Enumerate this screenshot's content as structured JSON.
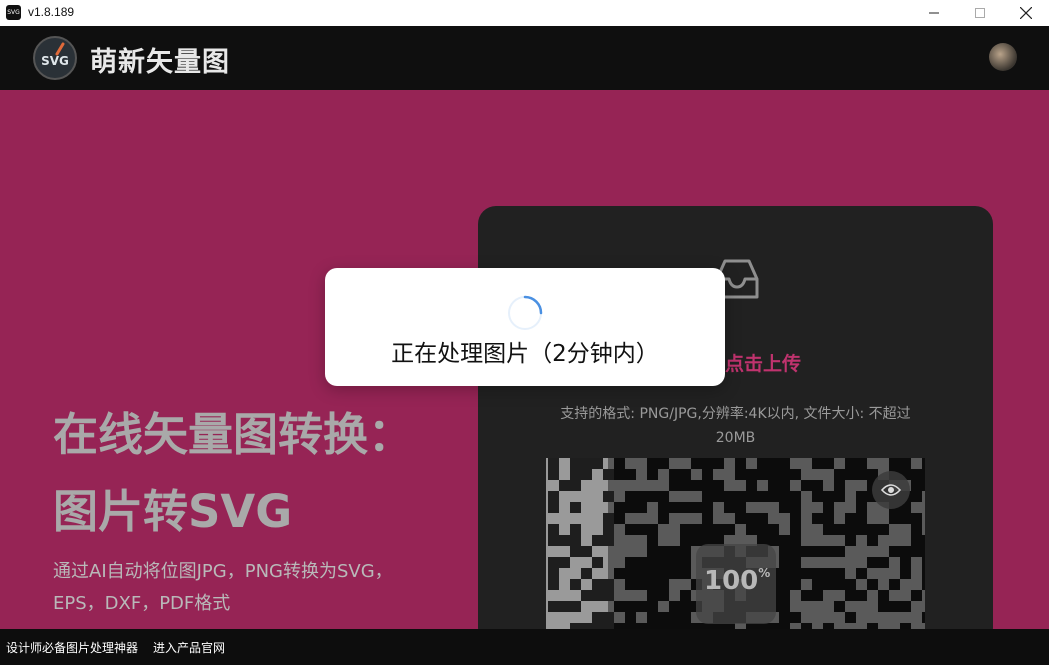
{
  "window": {
    "version": "v1.8.189",
    "app_icon_text": "SVG"
  },
  "header": {
    "logo_badge_text": "SVG",
    "brand_name": "萌新矢量图"
  },
  "hero": {
    "title_line1": "在线矢量图转换：",
    "title_line2": "图片转SVG",
    "description": "通过AI自动将位图JPG，PNG转换为SVG，EPS，DXF，PDF格式"
  },
  "upload": {
    "action_text": "点击上传",
    "support_text": "支持的格式: PNG/JPG,分辨率:4K以内, 文件大小: 不超过20MB",
    "progress_value": "100",
    "progress_unit": "%"
  },
  "modal": {
    "message": "正在处理图片（2分钟内）"
  },
  "footer": {
    "links": [
      "设计师必备图片处理神器",
      "进入产品官网"
    ]
  },
  "colors": {
    "hero_bg": "#962455",
    "accent": "#c0336e",
    "header_bg": "#0f0f0f",
    "card_bg": "#212121"
  },
  "icons": {
    "inbox": "inbox-icon",
    "eye": "eye-icon",
    "spinner": "loading-spinner",
    "minimize": "minimize-icon",
    "maximize": "maximize-icon",
    "close": "close-icon"
  }
}
